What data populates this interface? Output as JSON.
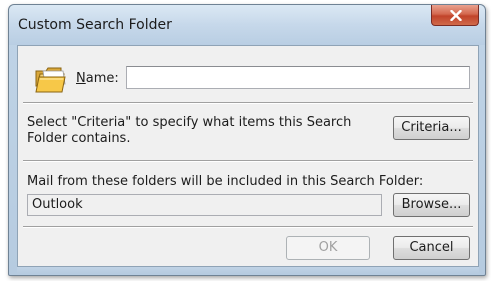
{
  "window": {
    "title": "Custom Search Folder",
    "close_icon": "close-x-icon"
  },
  "name_section": {
    "icon": "search-folder-icon",
    "label_accel": "N",
    "label_rest": "ame:",
    "value": ""
  },
  "criteria_section": {
    "description": "Select \"Criteria\" to specify what items this Search Folder contains.",
    "button_label": "Criteria..."
  },
  "folders_section": {
    "description": "Mail from these folders will be included in this Search Folder:",
    "value": "Outlook",
    "browse_label": "Browse..."
  },
  "footer": {
    "ok_label": "OK",
    "ok_enabled": false,
    "cancel_label": "Cancel"
  },
  "colors": {
    "title_bar": "#c6d8ea",
    "client_bg": "#f0f0f0",
    "close_button": "#c1432a"
  }
}
